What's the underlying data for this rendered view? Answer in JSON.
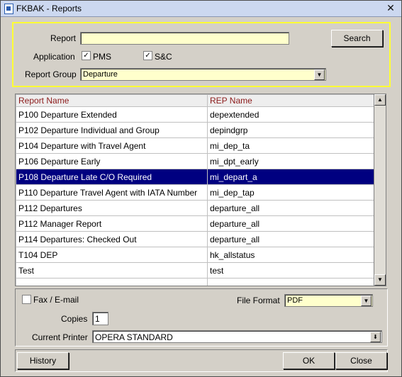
{
  "window": {
    "title": "FKBAK - Reports"
  },
  "criteria": {
    "report_label": "Report",
    "report_value": "",
    "search_button": "Search",
    "application_label": "Application",
    "pms_label": "PMS",
    "pms_checked": true,
    "sc_label": "S&C",
    "sc_checked": true,
    "report_group_label": "Report Group",
    "report_group_value": "Departure"
  },
  "grid": {
    "columns": [
      "Report Name",
      "REP Name"
    ],
    "rows": [
      [
        "P100 Departure Extended",
        "depextended"
      ],
      [
        "P102 Departure Individual and Group",
        "depindgrp"
      ],
      [
        "P104 Departure with Travel Agent",
        "mi_dep_ta"
      ],
      [
        "P106 Departure Early",
        "mi_dpt_early"
      ],
      [
        "P108 Departure Late C/O Required",
        "mi_depart_a"
      ],
      [
        "P110 Departure Travel Agent with IATA Number",
        "mi_dep_tap"
      ],
      [
        "P112 Departures",
        "departure_all"
      ],
      [
        "P112 Manager Report",
        "departure_all"
      ],
      [
        "P114 Departures: Checked Out",
        "departure_all"
      ],
      [
        "T104 DEP",
        "hk_allstatus"
      ],
      [
        "Test",
        "test"
      ],
      [
        "",
        ""
      ]
    ],
    "selected_index": 4
  },
  "output": {
    "fax_label": "Fax / E-mail",
    "fax_checked": false,
    "file_format_label": "File Format",
    "file_format_value": "PDF",
    "copies_label": "Copies",
    "copies_value": "1",
    "printer_label": "Current Printer",
    "printer_value": "OPERA STANDARD"
  },
  "footer": {
    "history_button": "History",
    "ok_button": "OK",
    "close_button": "Close"
  },
  "colors": {
    "highlight": "#ffff33",
    "selection": "#000080",
    "input_bg": "#ffffcc",
    "header_text": "#8b1a1a"
  }
}
